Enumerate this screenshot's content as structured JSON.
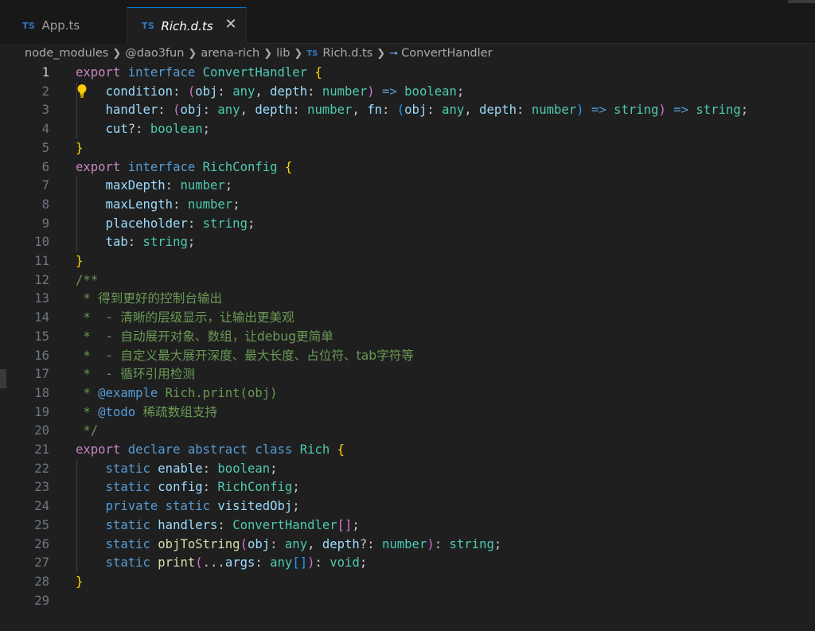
{
  "tabs": [
    {
      "icon": "TS",
      "label": "App.ts",
      "active": false
    },
    {
      "icon": "TS",
      "label": "Rich.d.ts",
      "active": true,
      "close": "✕"
    }
  ],
  "breadcrumb": {
    "segments": [
      "node_modules",
      "@dao3fun",
      "arena-rich",
      "lib"
    ],
    "file_icon": "TS",
    "file": "Rich.d.ts",
    "symbol": "ConvertHandler"
  },
  "editor": {
    "current_line": 1,
    "lines": [
      [
        {
          "t": "export",
          "c": "kwc"
        },
        {
          "t": " "
        },
        {
          "t": "interface",
          "c": "kw"
        },
        {
          "t": " "
        },
        {
          "t": "ConvertHandler",
          "c": "ty"
        },
        {
          "t": " "
        },
        {
          "t": "{",
          "c": "b1"
        }
      ],
      [
        {
          "t": "    "
        },
        {
          "t": "condition",
          "c": "prop"
        },
        {
          "t": ": ",
          "c": "pun"
        },
        {
          "t": "(",
          "c": "b2"
        },
        {
          "t": "obj",
          "c": "prop"
        },
        {
          "t": ": ",
          "c": "pun"
        },
        {
          "t": "any",
          "c": "ty"
        },
        {
          "t": ", ",
          "c": "pun"
        },
        {
          "t": "depth",
          "c": "prop"
        },
        {
          "t": ": ",
          "c": "pun"
        },
        {
          "t": "number",
          "c": "ty"
        },
        {
          "t": ")",
          "c": "b2"
        },
        {
          "t": " "
        },
        {
          "t": "=>",
          "c": "kw"
        },
        {
          "t": " "
        },
        {
          "t": "boolean",
          "c": "ty"
        },
        {
          "t": ";",
          "c": "pun"
        }
      ],
      [
        {
          "t": "    "
        },
        {
          "t": "handler",
          "c": "prop"
        },
        {
          "t": ": ",
          "c": "pun"
        },
        {
          "t": "(",
          "c": "b2"
        },
        {
          "t": "obj",
          "c": "prop"
        },
        {
          "t": ": ",
          "c": "pun"
        },
        {
          "t": "any",
          "c": "ty"
        },
        {
          "t": ", ",
          "c": "pun"
        },
        {
          "t": "depth",
          "c": "prop"
        },
        {
          "t": ": ",
          "c": "pun"
        },
        {
          "t": "number",
          "c": "ty"
        },
        {
          "t": ", ",
          "c": "pun"
        },
        {
          "t": "fn",
          "c": "prop"
        },
        {
          "t": ": ",
          "c": "pun"
        },
        {
          "t": "(",
          "c": "b3"
        },
        {
          "t": "obj",
          "c": "prop"
        },
        {
          "t": ": ",
          "c": "pun"
        },
        {
          "t": "any",
          "c": "ty"
        },
        {
          "t": ", ",
          "c": "pun"
        },
        {
          "t": "depth",
          "c": "prop"
        },
        {
          "t": ": ",
          "c": "pun"
        },
        {
          "t": "number",
          "c": "ty"
        },
        {
          "t": ")",
          "c": "b3"
        },
        {
          "t": " "
        },
        {
          "t": "=>",
          "c": "kw"
        },
        {
          "t": " "
        },
        {
          "t": "string",
          "c": "ty"
        },
        {
          "t": ")",
          "c": "b2"
        },
        {
          "t": " "
        },
        {
          "t": "=>",
          "c": "kw"
        },
        {
          "t": " "
        },
        {
          "t": "string",
          "c": "ty"
        },
        {
          "t": ";",
          "c": "pun"
        }
      ],
      [
        {
          "t": "    "
        },
        {
          "t": "cut",
          "c": "prop"
        },
        {
          "t": "?: ",
          "c": "pun"
        },
        {
          "t": "boolean",
          "c": "ty"
        },
        {
          "t": ";",
          "c": "pun"
        }
      ],
      [
        {
          "t": "}",
          "c": "b1"
        }
      ],
      [
        {
          "t": "export",
          "c": "kwc"
        },
        {
          "t": " "
        },
        {
          "t": "interface",
          "c": "kw"
        },
        {
          "t": " "
        },
        {
          "t": "RichConfig",
          "c": "ty"
        },
        {
          "t": " "
        },
        {
          "t": "{",
          "c": "b1"
        }
      ],
      [
        {
          "t": "    "
        },
        {
          "t": "maxDepth",
          "c": "prop"
        },
        {
          "t": ": ",
          "c": "pun"
        },
        {
          "t": "number",
          "c": "ty"
        },
        {
          "t": ";",
          "c": "pun"
        }
      ],
      [
        {
          "t": "    "
        },
        {
          "t": "maxLength",
          "c": "prop"
        },
        {
          "t": ": ",
          "c": "pun"
        },
        {
          "t": "number",
          "c": "ty"
        },
        {
          "t": ";",
          "c": "pun"
        }
      ],
      [
        {
          "t": "    "
        },
        {
          "t": "placeholder",
          "c": "prop"
        },
        {
          "t": ": ",
          "c": "pun"
        },
        {
          "t": "string",
          "c": "ty"
        },
        {
          "t": ";",
          "c": "pun"
        }
      ],
      [
        {
          "t": "    "
        },
        {
          "t": "tab",
          "c": "prop"
        },
        {
          "t": ": ",
          "c": "pun"
        },
        {
          "t": "string",
          "c": "ty"
        },
        {
          "t": ";",
          "c": "pun"
        }
      ],
      [
        {
          "t": "}",
          "c": "b1"
        }
      ],
      [
        {
          "t": "/**",
          "c": "cm"
        }
      ],
      [
        {
          "t": " * ",
          "c": "cm"
        },
        {
          "t": "得到更好的控制台输出",
          "c": "cm cjk"
        }
      ],
      [
        {
          "t": " *  - ",
          "c": "cm"
        },
        {
          "t": "清晰的层级显示，让输出更美观",
          "c": "cm cjk"
        }
      ],
      [
        {
          "t": " *  - ",
          "c": "cm"
        },
        {
          "t": "自动展开对象、数组，让debug更简单",
          "c": "cm cjk"
        }
      ],
      [
        {
          "t": " *  - ",
          "c": "cm"
        },
        {
          "t": "自定义最大展开深度、最大长度、占位符、tab字符等",
          "c": "cm cjk"
        }
      ],
      [
        {
          "t": " *  - ",
          "c": "cm"
        },
        {
          "t": "循环引用检测",
          "c": "cm cjk"
        }
      ],
      [
        {
          "t": " * ",
          "c": "cm"
        },
        {
          "t": "@example",
          "c": "cmt"
        },
        {
          "t": " Rich.print(obj)",
          "c": "cm"
        }
      ],
      [
        {
          "t": " * ",
          "c": "cm"
        },
        {
          "t": "@todo",
          "c": "cmt"
        },
        {
          "t": " ",
          "c": "cm"
        },
        {
          "t": "稀疏数组支持",
          "c": "cm cjk"
        }
      ],
      [
        {
          "t": " */",
          "c": "cm"
        }
      ],
      [
        {
          "t": "export",
          "c": "kwc"
        },
        {
          "t": " "
        },
        {
          "t": "declare",
          "c": "kw"
        },
        {
          "t": " "
        },
        {
          "t": "abstract",
          "c": "kw"
        },
        {
          "t": " "
        },
        {
          "t": "class",
          "c": "kw"
        },
        {
          "t": " "
        },
        {
          "t": "Rich",
          "c": "ty"
        },
        {
          "t": " "
        },
        {
          "t": "{",
          "c": "b1"
        }
      ],
      [
        {
          "t": "    "
        },
        {
          "t": "static",
          "c": "kw"
        },
        {
          "t": " "
        },
        {
          "t": "enable",
          "c": "prop"
        },
        {
          "t": ": ",
          "c": "pun"
        },
        {
          "t": "boolean",
          "c": "ty"
        },
        {
          "t": ";",
          "c": "pun"
        }
      ],
      [
        {
          "t": "    "
        },
        {
          "t": "static",
          "c": "kw"
        },
        {
          "t": " "
        },
        {
          "t": "config",
          "c": "prop"
        },
        {
          "t": ": ",
          "c": "pun"
        },
        {
          "t": "RichConfig",
          "c": "ty"
        },
        {
          "t": ";",
          "c": "pun"
        }
      ],
      [
        {
          "t": "    "
        },
        {
          "t": "private",
          "c": "kw"
        },
        {
          "t": " "
        },
        {
          "t": "static",
          "c": "kw"
        },
        {
          "t": " "
        },
        {
          "t": "visitedObj",
          "c": "prop"
        },
        {
          "t": ";",
          "c": "pun"
        }
      ],
      [
        {
          "t": "    "
        },
        {
          "t": "static",
          "c": "kw"
        },
        {
          "t": " "
        },
        {
          "t": "handlers",
          "c": "prop"
        },
        {
          "t": ": ",
          "c": "pun"
        },
        {
          "t": "ConvertHandler",
          "c": "ty"
        },
        {
          "t": "[]",
          "c": "b2"
        },
        {
          "t": ";",
          "c": "pun"
        }
      ],
      [
        {
          "t": "    "
        },
        {
          "t": "static",
          "c": "kw"
        },
        {
          "t": " "
        },
        {
          "t": "objToString",
          "c": "fn"
        },
        {
          "t": "(",
          "c": "b2"
        },
        {
          "t": "obj",
          "c": "prop"
        },
        {
          "t": ": ",
          "c": "pun"
        },
        {
          "t": "any",
          "c": "ty"
        },
        {
          "t": ", ",
          "c": "pun"
        },
        {
          "t": "depth",
          "c": "prop"
        },
        {
          "t": "?: ",
          "c": "pun"
        },
        {
          "t": "number",
          "c": "ty"
        },
        {
          "t": ")",
          "c": "b2"
        },
        {
          "t": ": ",
          "c": "pun"
        },
        {
          "t": "string",
          "c": "ty"
        },
        {
          "t": ";",
          "c": "pun"
        }
      ],
      [
        {
          "t": "    "
        },
        {
          "t": "static",
          "c": "kw"
        },
        {
          "t": " "
        },
        {
          "t": "print",
          "c": "fn"
        },
        {
          "t": "(",
          "c": "b2"
        },
        {
          "t": "...",
          "c": "pun"
        },
        {
          "t": "args",
          "c": "prop"
        },
        {
          "t": ": ",
          "c": "pun"
        },
        {
          "t": "any",
          "c": "ty"
        },
        {
          "t": "[]",
          "c": "b3"
        },
        {
          "t": ")",
          "c": "b2"
        },
        {
          "t": ": ",
          "c": "pun"
        },
        {
          "t": "void",
          "c": "ty"
        },
        {
          "t": ";",
          "c": "pun"
        }
      ],
      [
        {
          "t": "}",
          "c": "b1"
        }
      ],
      []
    ],
    "lightbulb": {
      "line": 2,
      "icon": "lightbulb-icon"
    }
  }
}
